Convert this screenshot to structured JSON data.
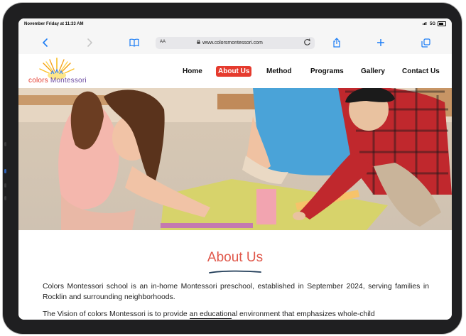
{
  "device": {
    "status_time": "November Friday at 11:33 AM",
    "signal": "5G"
  },
  "browser": {
    "text_size_label": "AA",
    "url": "www.colorsmontessori.com",
    "icons": {
      "back": "chevron-left-icon",
      "forward": "chevron-right-icon",
      "bookmarks": "book-icon",
      "lock": "lock-icon",
      "reload": "reload-icon",
      "share": "share-icon",
      "new_tab": "plus-icon",
      "tabs": "tabs-icon"
    },
    "accent_color": "#1a7cf5"
  },
  "site": {
    "logo_text_colors": "colors",
    "logo_text_montessori": "Montessori",
    "nav": {
      "home": "Home",
      "about": "About Us",
      "method": "Method",
      "programs": "Programs",
      "gallery": "Gallery",
      "contact": "Contact Us"
    },
    "active_nav_color": "#e53b2e",
    "about": {
      "title": "About Us",
      "paragraph1": "Colors Montessori school is an in-home Montessori preschool, established in September 2024, serving families in Rocklin and surrounding neighborhoods.",
      "paragraph2_pre": "The Vision of colors Montessori is to provide ",
      "paragraph2_highlight": "an education",
      "paragraph2_post": "al environment that emphasizes whole-child"
    }
  }
}
